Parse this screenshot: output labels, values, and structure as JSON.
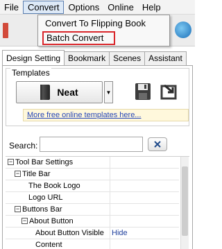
{
  "menubar": {
    "items": [
      "File",
      "Convert",
      "Options",
      "Online",
      "Help"
    ]
  },
  "dropdown": {
    "items": [
      "Convert To Flipping Book",
      "Batch Convert"
    ]
  },
  "tabs": [
    "Design Setting",
    "Bookmark",
    "Scenes",
    "Assistant"
  ],
  "templates": {
    "group_label": "Templates",
    "selected": "Neat",
    "more_link": "More free online templates here..."
  },
  "search": {
    "label": "Search:",
    "value": ""
  },
  "tree": {
    "rows": [
      {
        "label": "Tool Bar Settings",
        "expander": "−",
        "value": ""
      },
      {
        "label": "Title Bar",
        "expander": "−",
        "value": ""
      },
      {
        "label": "The Book Logo",
        "expander": "",
        "value": ""
      },
      {
        "label": "Logo URL",
        "expander": "",
        "value": ""
      },
      {
        "label": "Buttons Bar",
        "expander": "−",
        "value": ""
      },
      {
        "label": "About Button",
        "expander": "−",
        "value": ""
      },
      {
        "label": "About Button Visible",
        "expander": "",
        "value": "Hide"
      },
      {
        "label": "Content",
        "expander": "",
        "value": ""
      }
    ]
  },
  "colors": {
    "highlight_border": "#d9252a",
    "link": "#2646b8",
    "value_text": "#1f3f9c"
  }
}
